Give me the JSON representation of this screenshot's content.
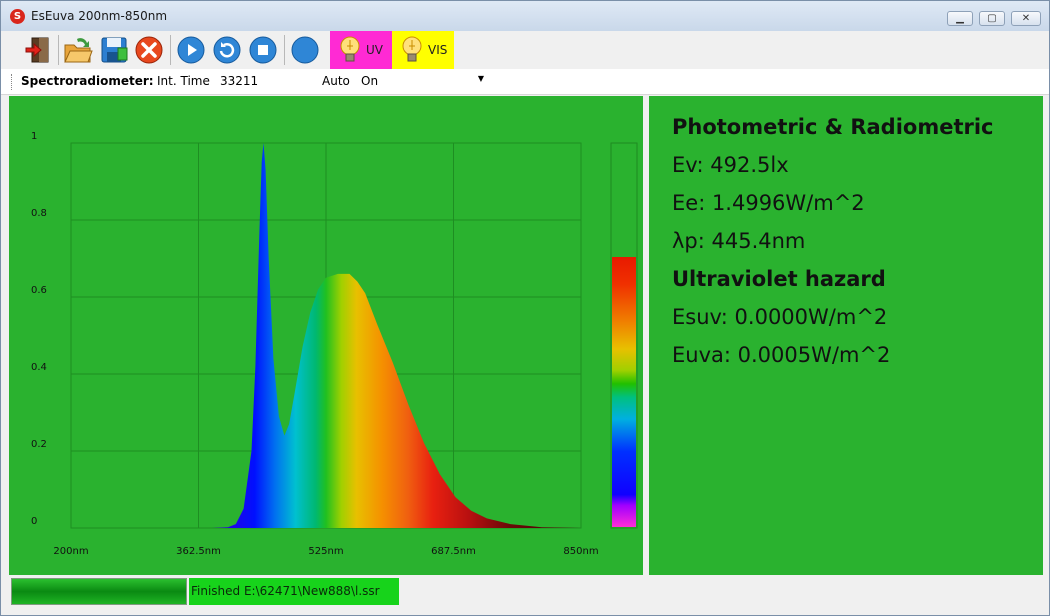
{
  "window": {
    "title": "EsEuva 200nm-850nm",
    "app_icon_letter": "S",
    "minimize_icon": "minimize-icon",
    "maximize_icon": "maximize-icon",
    "close_icon": "close-icon"
  },
  "toolbar": {
    "buttons": [
      "exit-icon",
      "open-folder-icon",
      "save-icon",
      "stop-icon",
      "play-icon",
      "refresh-icon",
      "stop-square-icon",
      "moon-icon"
    ],
    "uv_label": "UV",
    "vis_label": "VIS",
    "uv_color": "#ff2ad4",
    "vis_color": "#ffff00"
  },
  "settings": {
    "device_label": "Spectroradiometer:",
    "int_time_label": "Int. Time",
    "int_time_value": "33211",
    "auto_label": "Auto",
    "auto_value": "On"
  },
  "chart_data": {
    "type": "area",
    "xlabel": "",
    "ylabel": "",
    "x_tick_labels": [
      "200nm",
      "362.5nm",
      "525nm",
      "687.5nm",
      "850nm"
    ],
    "y_tick_labels": [
      "0",
      "0.2",
      "0.4",
      "0.6",
      "0.8",
      "1"
    ],
    "xlim": [
      200,
      850
    ],
    "ylim": [
      0,
      1
    ],
    "grid": true,
    "background": "#2ab22f",
    "x": [
      200,
      380,
      400,
      410,
      420,
      430,
      435,
      440,
      443,
      445.4,
      448,
      452,
      458,
      465,
      472,
      478,
      485,
      495,
      505,
      515,
      525,
      540,
      555,
      565,
      575,
      590,
      610,
      630,
      650,
      670,
      690,
      710,
      730,
      760,
      800,
      850
    ],
    "values": [
      0,
      0,
      0.002,
      0.01,
      0.05,
      0.2,
      0.42,
      0.76,
      0.95,
      1.0,
      0.93,
      0.7,
      0.44,
      0.29,
      0.24,
      0.27,
      0.35,
      0.47,
      0.56,
      0.62,
      0.65,
      0.66,
      0.66,
      0.64,
      0.61,
      0.53,
      0.43,
      0.32,
      0.22,
      0.14,
      0.08,
      0.045,
      0.025,
      0.01,
      0.002,
      0
    ],
    "colorbar": true
  },
  "info": {
    "heading1": "Photometric & Radiometric",
    "ev": "Ev: 492.5lx",
    "ee": "Ee: 1.4996W/m^2",
    "lp": "λp: 445.4nm",
    "heading2": "Ultraviolet hazard",
    "esuv": "Esuv: 0.0000W/m^2",
    "euva": "Euva: 0.0005W/m^2"
  },
  "status": {
    "progress": 1.0,
    "text": "Finished E:\\62471\\New888\\l.ssr"
  }
}
